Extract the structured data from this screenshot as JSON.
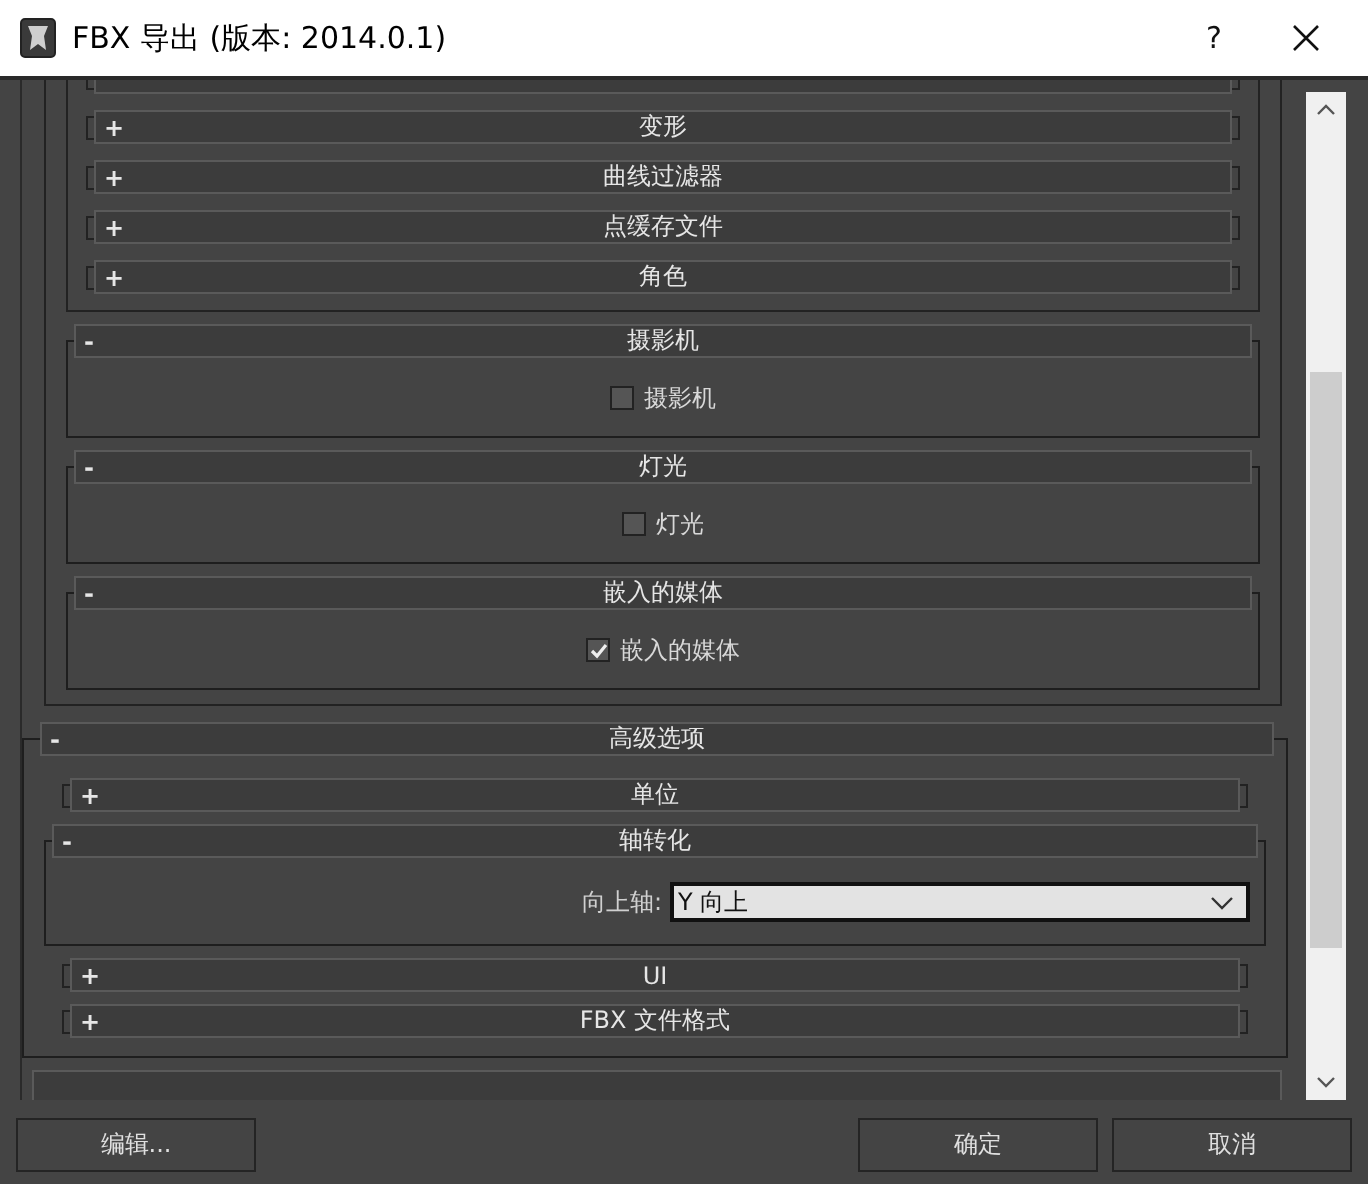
{
  "window": {
    "title": "FBX 导出 (版本: 2014.0.1)",
    "help": "?"
  },
  "include_group": {
    "rollouts": [
      {
        "toggle": "+",
        "title": "变形",
        "expanded": false
      },
      {
        "toggle": "+",
        "title": "曲线过滤器",
        "expanded": false
      },
      {
        "toggle": "+",
        "title": "点缓存文件",
        "expanded": false
      },
      {
        "toggle": "+",
        "title": "角色",
        "expanded": false
      }
    ]
  },
  "rollouts": [
    {
      "toggle": "-",
      "title": "摄影机",
      "expanded": true,
      "checkbox": {
        "label": "摄影机",
        "checked": false
      }
    },
    {
      "toggle": "-",
      "title": "灯光",
      "expanded": true,
      "checkbox": {
        "label": "灯光",
        "checked": false
      }
    },
    {
      "toggle": "-",
      "title": "嵌入的媒体",
      "expanded": true,
      "checkbox": {
        "label": "嵌入的媒体",
        "checked": true
      }
    }
  ],
  "advanced": {
    "toggle": "-",
    "title": "高级选项",
    "expanded": true,
    "children": [
      {
        "toggle": "+",
        "title": "单位",
        "expanded": false
      },
      {
        "toggle": "-",
        "title": "轴转化",
        "expanded": true,
        "dropdown": {
          "label": "向上轴:",
          "value": "Y 向上"
        }
      },
      {
        "toggle": "+",
        "title": "UI",
        "expanded": false
      },
      {
        "toggle": "+",
        "title": "FBX 文件格式",
        "expanded": false
      }
    ]
  },
  "buttons": [
    {
      "label": "编辑..."
    },
    {
      "label": "确定"
    },
    {
      "label": "取消"
    }
  ]
}
